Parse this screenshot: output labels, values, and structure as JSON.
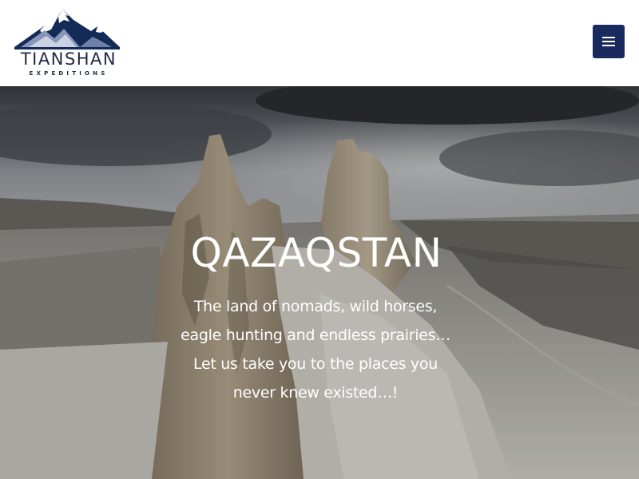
{
  "header": {
    "logo": {
      "name": "TIANSHAN",
      "subtitle": "EXPEDITIONS",
      "icon": "mountain-logo-icon"
    },
    "menu_button": {
      "icon": "hamburger-menu-icon",
      "color": "#1b2a5e"
    }
  },
  "hero": {
    "title": "QAZAQSTAN",
    "lines": [
      "The land of nomads, wild horses,",
      "eagle hunting and endless prairies…",
      "Let us take you to the places you",
      "never knew existed…!"
    ]
  },
  "colors": {
    "brand_navy": "#1b2a5e",
    "logo_text": "#1f2a44"
  }
}
